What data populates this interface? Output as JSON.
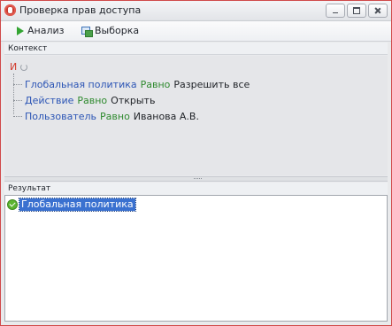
{
  "window": {
    "title": "Проверка прав доступа"
  },
  "toolbar": {
    "analyze_label": "Анализ",
    "select_label": "Выборка"
  },
  "context": {
    "header": "Контекст",
    "operator": "И",
    "conditions": [
      {
        "field": "Глобальная политика",
        "op": "Равно",
        "value": "Разрешить все"
      },
      {
        "field": "Действие",
        "op": "Равно",
        "value": "Открыть"
      },
      {
        "field": "Пользователь",
        "op": "Равно",
        "value": "Иванова А.В."
      }
    ]
  },
  "result": {
    "header": "Результат",
    "items": [
      {
        "label": "Глобальная политика"
      }
    ]
  },
  "colors": {
    "field": "#2c55b5",
    "operator": "#2f8a2f",
    "and": "#d23a2c",
    "selection": "#3a71d0",
    "window_border": "#d04a4a"
  }
}
